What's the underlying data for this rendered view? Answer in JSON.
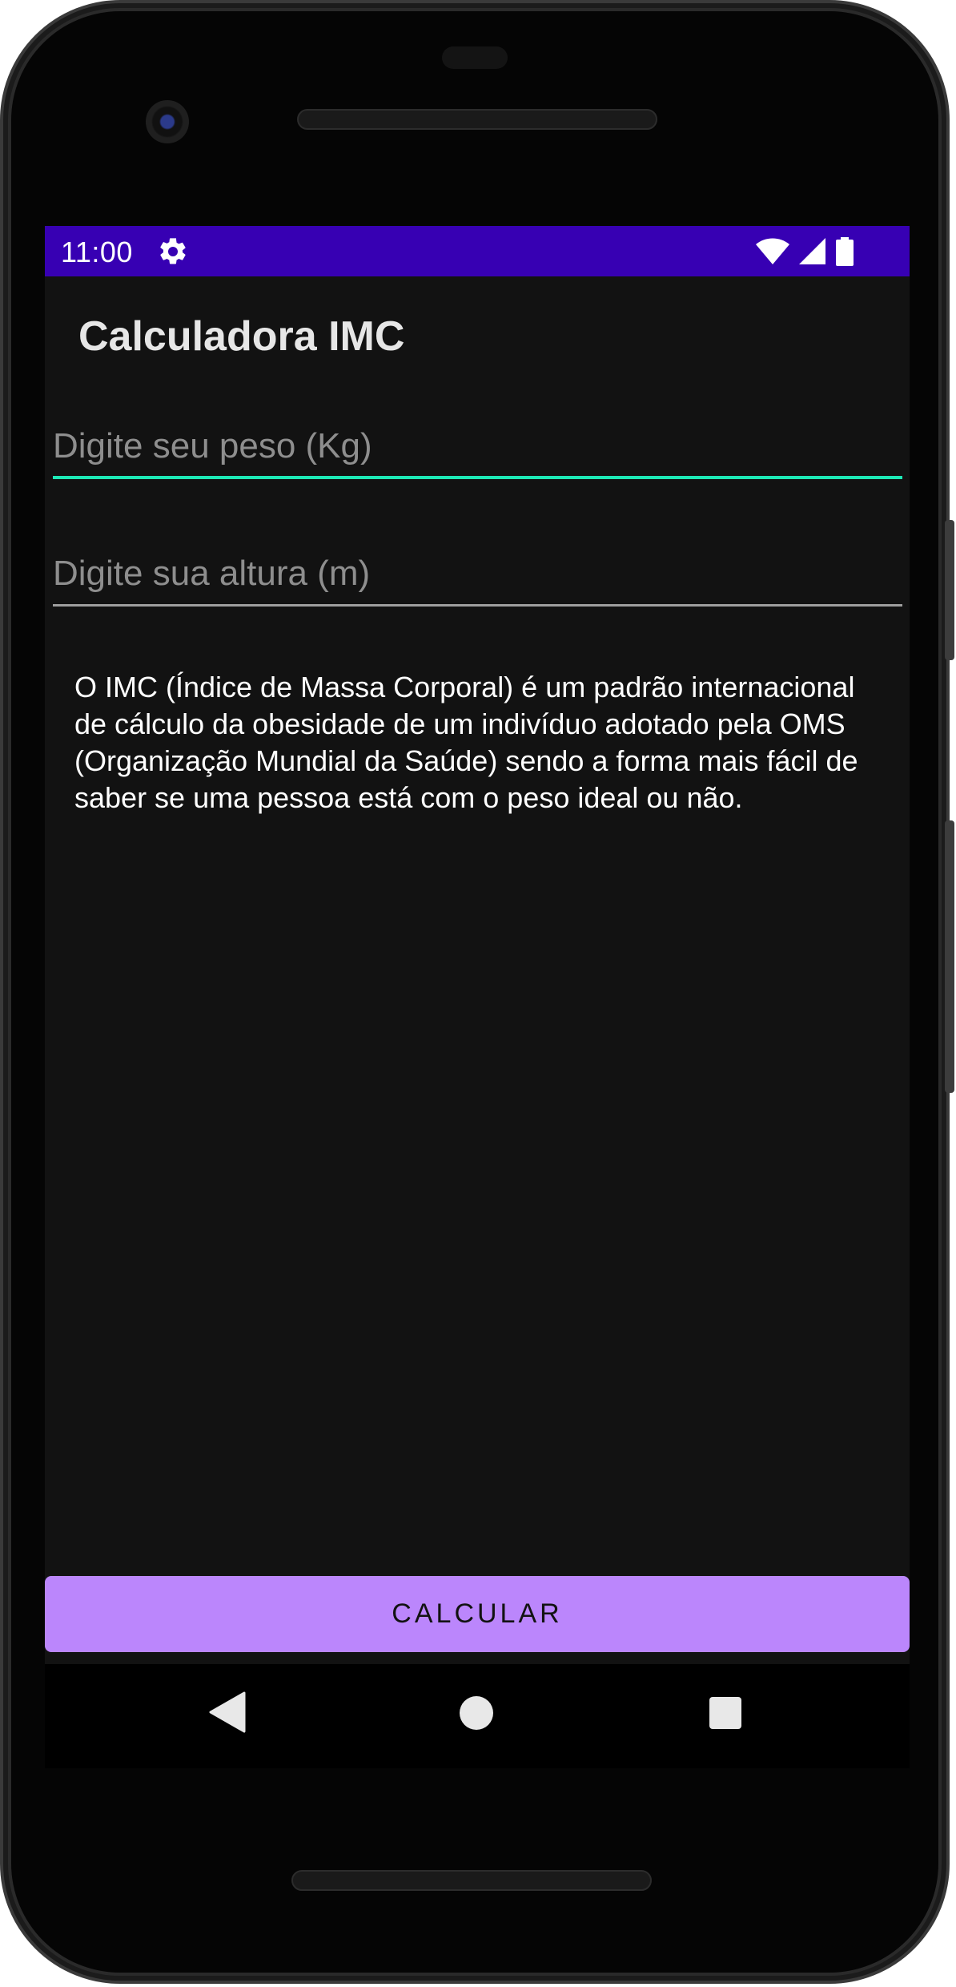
{
  "status_bar": {
    "time": "11:00",
    "settings_icon": "gear-icon",
    "wifi_icon": "wifi-icon",
    "signal_icon": "signal-icon",
    "battery_icon": "battery-icon",
    "background_color": "#3700b3"
  },
  "app": {
    "title": "Calculadora IMC"
  },
  "form": {
    "weight_value": "",
    "weight_placeholder": "Digite seu peso (Kg)",
    "height_value": "",
    "height_placeholder": "Digite sua altura (m)",
    "focused_underline_color": "#1de9b6"
  },
  "description": {
    "text": "O IMC (Índice de Massa Corporal) é um padrão internacional de cálculo da obesidade de um indivíduo adotado pela OMS (Organização Mundial da Saúde) sendo a forma mais fácil de saber se uma pessoa está com o peso ideal ou não."
  },
  "actions": {
    "calculate_label": "CALCULAR",
    "button_color": "#bb86fc"
  },
  "navigation": {
    "back_icon": "back-triangle-icon",
    "home_icon": "home-circle-icon",
    "recents_icon": "recents-square-icon"
  }
}
